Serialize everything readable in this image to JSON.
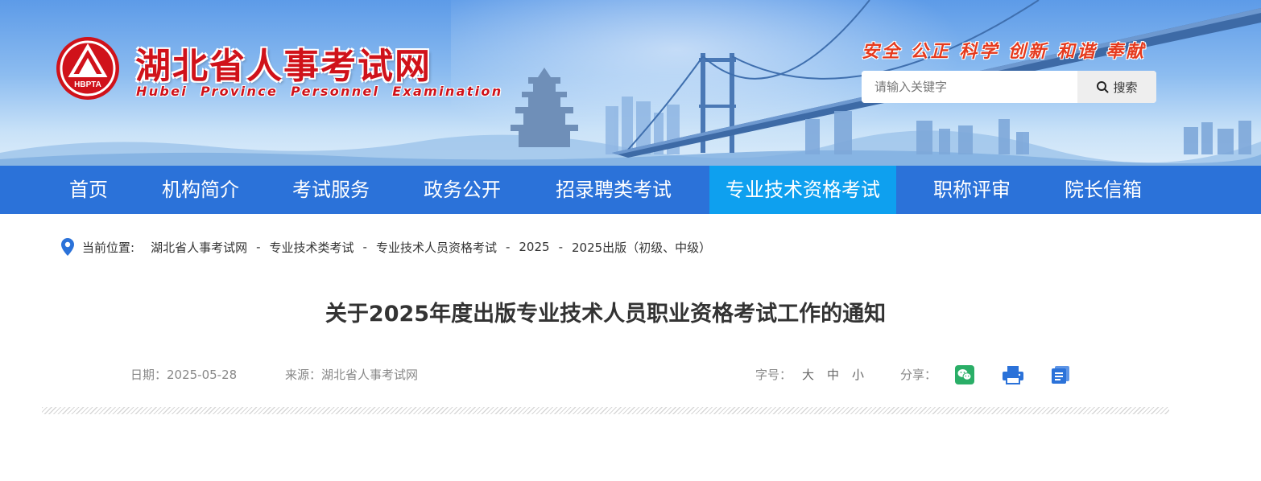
{
  "header": {
    "logo_text": "HBPTA",
    "site_title": "湖北省人事考试网",
    "site_subtitle": "Hubei Province Personnel Examination",
    "slogan": "安全 公正 科学 创新 和谐 奉献",
    "search": {
      "placeholder": "请输入关键字",
      "value": "",
      "button_label": "搜索"
    }
  },
  "nav": {
    "items": [
      {
        "label": "首页"
      },
      {
        "label": "机构简介"
      },
      {
        "label": "考试服务"
      },
      {
        "label": "政务公开"
      },
      {
        "label": "招录聘类考试"
      },
      {
        "label": "专业技术资格考试",
        "active": true
      },
      {
        "label": "职称评审"
      },
      {
        "label": "院长信箱"
      }
    ]
  },
  "breadcrumb": {
    "label": "当前位置:",
    "items": [
      "湖北省人事考试网",
      "专业技术类考试",
      "专业技术人员资格考试",
      "2025",
      "2025出版（初级、中级）"
    ],
    "separator": "-"
  },
  "article": {
    "title": "关于2025年度出版专业技术人员职业资格考试工作的通知",
    "date": "日期：2025-05-28",
    "source": "来源：湖北省人事考试网",
    "font_size_label": "字号：",
    "font_sizes": [
      "大",
      "中",
      "小"
    ],
    "share_label": "分享：",
    "share_icons": [
      "wechat-icon",
      "print-icon",
      "copy-icon"
    ]
  },
  "colors": {
    "nav_bg": "#2b72d9",
    "nav_active_bg": "#0ea0ef",
    "title_red": "#d0121a",
    "slogan_red": "#e53a1e",
    "wechat_green": "#2aae67",
    "icon_blue": "#2b72d9"
  }
}
